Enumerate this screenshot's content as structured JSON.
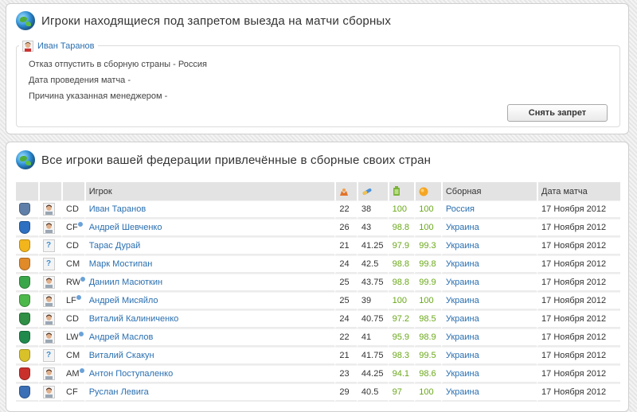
{
  "ban_panel": {
    "title": "Игроки находящиеся под запретом выезда на матчи сборных",
    "player_name": "Иван Таранов",
    "line1": "Отказ отпустить в сборную страны - Россия",
    "line2": "Дата проведения матча -",
    "line3": "Причина указанная менеджером -",
    "button_label": "Снять запрет"
  },
  "players_panel": {
    "title": "Все игроки вашей федерации привлечённые в сборные своих стран",
    "columns": {
      "player": "Игрок",
      "age_icon": "age-icon",
      "skill_icon": "skill-icon",
      "fitness_icon": "fitness-icon",
      "form_icon": "form-icon",
      "national_team": "Сборная",
      "match_date": "Дата матча"
    },
    "rows": [
      {
        "club_color": "#5f7fa8",
        "photo": true,
        "pos": "CD",
        "dot": false,
        "name": "Иван Таранов",
        "age": "22",
        "skill": "38",
        "fit": "100",
        "form": "100",
        "team": "Россия",
        "date": "17 Ноября 2012"
      },
      {
        "club_color": "#2d6fc0",
        "photo": true,
        "pos": "CF",
        "dot": true,
        "name": "Андрей Шевченко",
        "age": "26",
        "skill": "43",
        "fit": "98.8",
        "form": "100",
        "team": "Украина",
        "date": "17 Ноября 2012"
      },
      {
        "club_color": "#f2b51b",
        "photo": false,
        "pos": "CD",
        "dot": false,
        "name": "Тарас Дурай",
        "age": "21",
        "skill": "41.25",
        "fit": "97.9",
        "form": "99.3",
        "team": "Украина",
        "date": "17 Ноября 2012"
      },
      {
        "club_color": "#e08a2a",
        "photo": false,
        "pos": "CM",
        "dot": false,
        "name": "Марк Мостипан",
        "age": "24",
        "skill": "42.5",
        "fit": "98.8",
        "form": "99.8",
        "team": "Украина",
        "date": "17 Ноября 2012"
      },
      {
        "club_color": "#3aa64a",
        "photo": true,
        "pos": "RW",
        "dot": true,
        "name": "Даниил Масюткин",
        "age": "25",
        "skill": "43.75",
        "fit": "98.8",
        "form": "99.9",
        "team": "Украина",
        "date": "17 Ноября 2012"
      },
      {
        "club_color": "#4cb84a",
        "photo": true,
        "pos": "LF",
        "dot": true,
        "name": "Андрей Мисяйло",
        "age": "25",
        "skill": "39",
        "fit": "100",
        "form": "100",
        "team": "Украина",
        "date": "17 Ноября 2012"
      },
      {
        "club_color": "#2e8f45",
        "photo": true,
        "pos": "CD",
        "dot": false,
        "name": "Виталий Калиниченко",
        "age": "24",
        "skill": "40.75",
        "fit": "97.2",
        "form": "98.5",
        "team": "Украина",
        "date": "17 Ноября 2012"
      },
      {
        "club_color": "#1f8a4c",
        "photo": true,
        "pos": "LW",
        "dot": true,
        "name": "Андрей Маслов",
        "age": "22",
        "skill": "41",
        "fit": "95.9",
        "form": "98.9",
        "team": "Украина",
        "date": "17 Ноября 2012"
      },
      {
        "club_color": "#d9c12a",
        "photo": false,
        "pos": "CM",
        "dot": false,
        "name": "Виталий Скакун",
        "age": "21",
        "skill": "41.75",
        "fit": "98.3",
        "form": "99.5",
        "team": "Украина",
        "date": "17 Ноября 2012"
      },
      {
        "club_color": "#c9302c",
        "photo": true,
        "pos": "AM",
        "dot": true,
        "name": "Антон Поступаленко",
        "age": "23",
        "skill": "44.25",
        "fit": "94.1",
        "form": "98.6",
        "team": "Украина",
        "date": "17 Ноября 2012"
      },
      {
        "club_color": "#3b6fb6",
        "photo": true,
        "pos": "CF",
        "dot": false,
        "name": "Руслан Левига",
        "age": "29",
        "skill": "40.5",
        "fit": "97",
        "form": "100",
        "team": "Украина",
        "date": "17 Ноября 2012"
      }
    ]
  }
}
